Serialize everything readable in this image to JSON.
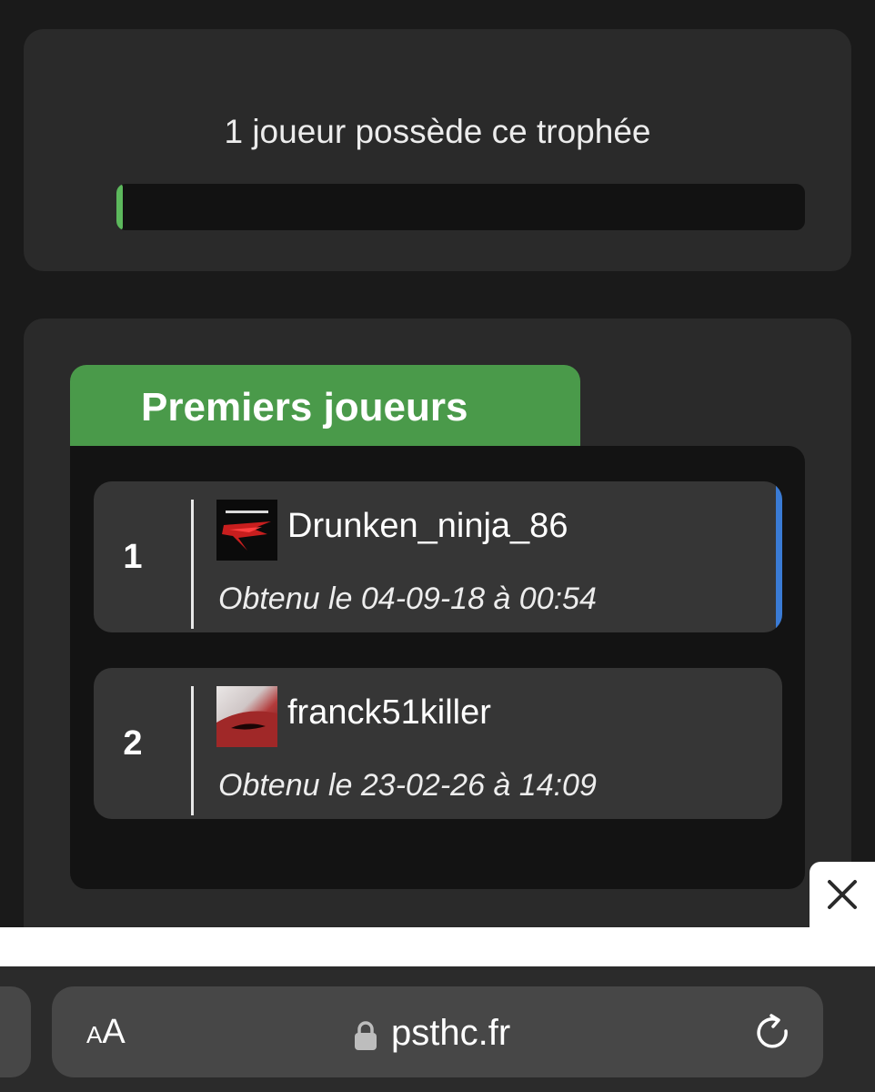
{
  "owners_card": {
    "text": "1 joueur possède ce trophée",
    "progress_percent": 0.5,
    "progress_color": "#5cb85c"
  },
  "first_players": {
    "title": "Premiers joueurs",
    "header_color": "#4a9a4a",
    "entries": [
      {
        "rank": "1",
        "username": "Drunken_ninja_86",
        "obtained": "Obtenu le 04-09-18 à 00:54",
        "avatar": "ninja-avatar",
        "highlight_color": "#3a7bd5"
      },
      {
        "rank": "2",
        "username": "franck51killer",
        "obtained": "Obtenu le 23-02-26 à 14:09",
        "avatar": "red-abstract-avatar"
      }
    ]
  },
  "overlay": {
    "close_icon": "close-icon"
  },
  "browser": {
    "text_size_small": "A",
    "text_size_big": "A",
    "url": "psthc.fr",
    "lock_icon": "lock-icon",
    "reload_icon": "reload-icon"
  }
}
